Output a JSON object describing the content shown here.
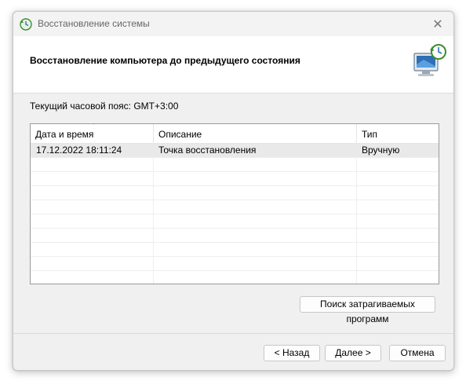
{
  "window": {
    "title": "Восстановление системы",
    "close_glyph": "✕"
  },
  "header": {
    "title": "Восстановление компьютера до предыдущего состояния"
  },
  "timezone_label": "Текущий часовой пояс: GMT+3:00",
  "table": {
    "columns": [
      "Дата и время",
      "Описание",
      "Тип"
    ],
    "rows": [
      {
        "datetime": "17.12.2022 18:11:24",
        "description": "Точка восстановления",
        "type": "Вручную"
      }
    ]
  },
  "buttons": {
    "scan": "Поиск затрагиваемых программ",
    "back": "< Назад",
    "next": "Далее >",
    "cancel": "Отмена"
  },
  "icons": {
    "app": "system-restore-icon",
    "header": "computer-restore-icon",
    "sort": "sort-descending-icon"
  },
  "colors": {
    "accent": "#3a8f2e",
    "selected_row": "#e9e9e9"
  }
}
